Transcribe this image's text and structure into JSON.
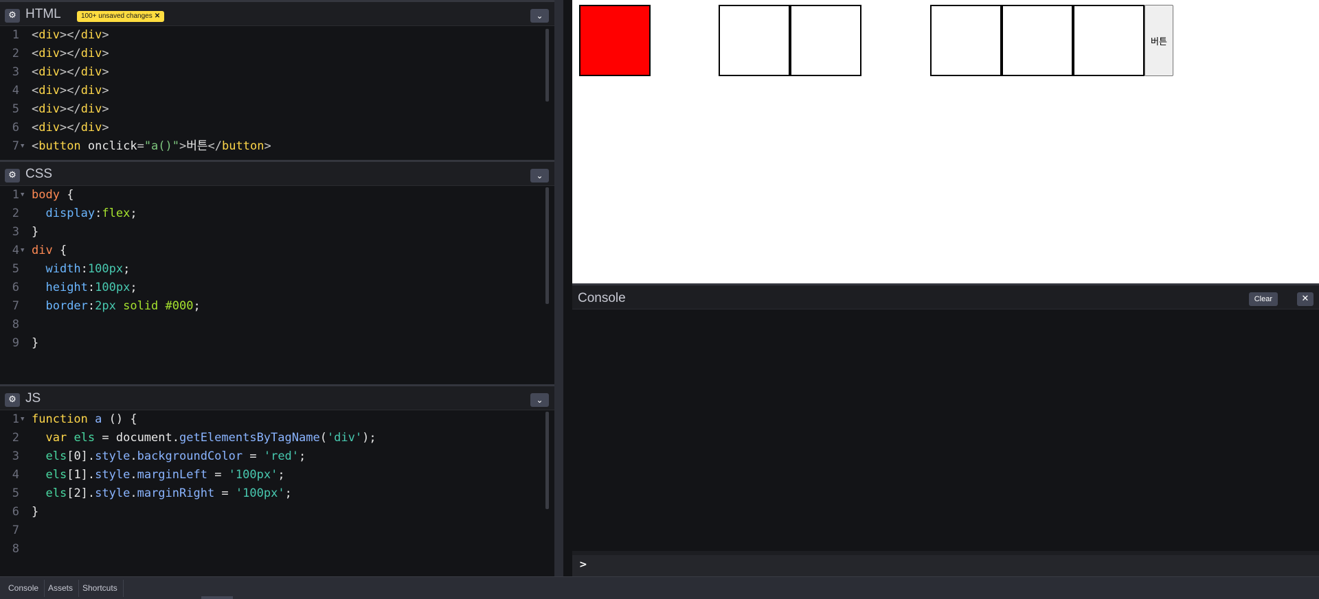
{
  "html_editor": {
    "title": "HTML",
    "badge": "100+ unsaved changes",
    "badge_close": "✕",
    "lines": [
      {
        "n": "1",
        "parts": [
          [
            "t-pun",
            "<"
          ],
          [
            "t-tag",
            "div"
          ],
          [
            "t-pun",
            "></"
          ],
          [
            "t-tag",
            "div"
          ],
          [
            "t-pun",
            ">"
          ]
        ]
      },
      {
        "n": "2",
        "parts": [
          [
            "t-pun",
            "<"
          ],
          [
            "t-tag",
            "div"
          ],
          [
            "t-pun",
            "></"
          ],
          [
            "t-tag",
            "div"
          ],
          [
            "t-pun",
            ">"
          ]
        ]
      },
      {
        "n": "3",
        "parts": [
          [
            "t-pun",
            "<"
          ],
          [
            "t-tag",
            "div"
          ],
          [
            "t-pun",
            "></"
          ],
          [
            "t-tag",
            "div"
          ],
          [
            "t-pun",
            ">"
          ]
        ]
      },
      {
        "n": "4",
        "parts": [
          [
            "t-pun",
            "<"
          ],
          [
            "t-tag",
            "div"
          ],
          [
            "t-pun",
            "></"
          ],
          [
            "t-tag",
            "div"
          ],
          [
            "t-pun",
            ">"
          ]
        ]
      },
      {
        "n": "5",
        "parts": [
          [
            "t-pun",
            "<"
          ],
          [
            "t-tag",
            "div"
          ],
          [
            "t-pun",
            "></"
          ],
          [
            "t-tag",
            "div"
          ],
          [
            "t-pun",
            ">"
          ]
        ]
      },
      {
        "n": "6",
        "parts": [
          [
            "t-pun",
            "<"
          ],
          [
            "t-tag",
            "div"
          ],
          [
            "t-pun",
            "></"
          ],
          [
            "t-tag",
            "div"
          ],
          [
            "t-pun",
            ">"
          ]
        ]
      },
      {
        "n": "7",
        "fold": true,
        "parts": [
          [
            "t-pun",
            "<"
          ],
          [
            "t-tag",
            "button"
          ],
          [
            "t-attr",
            " onclick"
          ],
          [
            "t-pun",
            "="
          ],
          [
            "t-strg",
            "\"a()\""
          ],
          [
            "t-pun",
            ">"
          ],
          [
            "t-attr",
            "버튼"
          ],
          [
            "t-pun",
            "</"
          ],
          [
            "t-tag",
            "button"
          ],
          [
            "t-pun",
            ">"
          ]
        ]
      }
    ]
  },
  "css_editor": {
    "title": "CSS",
    "lines": [
      {
        "n": "1",
        "fold": true,
        "parts": [
          [
            "t-sel",
            "body"
          ],
          [
            "t-plain",
            " {"
          ]
        ]
      },
      {
        "n": "2",
        "parts": [
          [
            "t-plain",
            "  "
          ],
          [
            "t-prop",
            "display"
          ],
          [
            "t-plain",
            ":"
          ],
          [
            "t-val",
            "flex"
          ],
          [
            "t-plain",
            ";"
          ]
        ]
      },
      {
        "n": "3",
        "parts": [
          [
            "t-plain",
            "}"
          ]
        ]
      },
      {
        "n": "4",
        "fold": true,
        "parts": [
          [
            "t-sel",
            "div"
          ],
          [
            "t-plain",
            " {"
          ]
        ]
      },
      {
        "n": "5",
        "parts": [
          [
            "t-plain",
            "  "
          ],
          [
            "t-prop",
            "width"
          ],
          [
            "t-plain",
            ":"
          ],
          [
            "t-num",
            "100px"
          ],
          [
            "t-plain",
            ";"
          ]
        ]
      },
      {
        "n": "6",
        "parts": [
          [
            "t-plain",
            "  "
          ],
          [
            "t-prop",
            "height"
          ],
          [
            "t-plain",
            ":"
          ],
          [
            "t-num",
            "100px"
          ],
          [
            "t-plain",
            ";"
          ]
        ]
      },
      {
        "n": "7",
        "parts": [
          [
            "t-plain",
            "  "
          ],
          [
            "t-prop",
            "border"
          ],
          [
            "t-plain",
            ":"
          ],
          [
            "t-num",
            "2px"
          ],
          [
            "t-val",
            " solid #000"
          ],
          [
            "t-plain",
            ";"
          ]
        ]
      },
      {
        "n": "8",
        "parts": []
      },
      {
        "n": "9",
        "parts": [
          [
            "t-plain",
            "}"
          ]
        ]
      }
    ]
  },
  "js_editor": {
    "title": "JS",
    "lines": [
      {
        "n": "1",
        "fold": true,
        "parts": [
          [
            "t-kw",
            "function"
          ],
          [
            "t-fn",
            " a"
          ],
          [
            "t-plain",
            " () {"
          ]
        ]
      },
      {
        "n": "2",
        "parts": [
          [
            "t-plain",
            "  "
          ],
          [
            "t-kw",
            "var"
          ],
          [
            "t-var",
            " els"
          ],
          [
            "t-plain",
            " = document."
          ],
          [
            "t-fn",
            "getElementsByTagName"
          ],
          [
            "t-plain",
            "("
          ],
          [
            "t-jsstr",
            "'div'"
          ],
          [
            "t-plain",
            ");"
          ]
        ]
      },
      {
        "n": "3",
        "parts": [
          [
            "t-plain",
            "  "
          ],
          [
            "t-var",
            "els"
          ],
          [
            "t-plain",
            "[0]."
          ],
          [
            "t-fn",
            "style"
          ],
          [
            "t-plain",
            "."
          ],
          [
            "t-fn",
            "backgroundColor"
          ],
          [
            "t-plain",
            " = "
          ],
          [
            "t-jsstr",
            "'red'"
          ],
          [
            "t-plain",
            ";"
          ]
        ]
      },
      {
        "n": "4",
        "parts": [
          [
            "t-plain",
            "  "
          ],
          [
            "t-var",
            "els"
          ],
          [
            "t-plain",
            "[1]."
          ],
          [
            "t-fn",
            "style"
          ],
          [
            "t-plain",
            "."
          ],
          [
            "t-fn",
            "marginLeft"
          ],
          [
            "t-plain",
            " = "
          ],
          [
            "t-jsstr",
            "'100px'"
          ],
          [
            "t-plain",
            ";"
          ]
        ]
      },
      {
        "n": "5",
        "parts": [
          [
            "t-plain",
            "  "
          ],
          [
            "t-var",
            "els"
          ],
          [
            "t-plain",
            "[2]."
          ],
          [
            "t-fn",
            "style"
          ],
          [
            "t-plain",
            "."
          ],
          [
            "t-fn",
            "marginRight"
          ],
          [
            "t-plain",
            " = "
          ],
          [
            "t-jsstr",
            "'100px'"
          ],
          [
            "t-plain",
            ";"
          ]
        ]
      },
      {
        "n": "6",
        "parts": [
          [
            "t-plain",
            "}"
          ]
        ]
      },
      {
        "n": "7",
        "parts": []
      },
      {
        "n": "8",
        "parts": []
      }
    ]
  },
  "preview": {
    "boxes": [
      {
        "color": "#ff0000"
      },
      {
        "color": "#ffffff"
      },
      {
        "color": "#ffffff"
      },
      {
        "color": "#ffffff"
      },
      {
        "color": "#ffffff"
      },
      {
        "color": "#ffffff"
      }
    ],
    "button_label": "버튼"
  },
  "console": {
    "title": "Console",
    "clear_label": "Clear",
    "close_label": "✕",
    "prompt": ">"
  },
  "bottombar": {
    "console_label": "Console",
    "assets_label": "Assets",
    "shortcuts_label": "Shortcuts"
  },
  "icons": {
    "gear": "gear-icon",
    "chevron": "chevron-down-icon"
  }
}
